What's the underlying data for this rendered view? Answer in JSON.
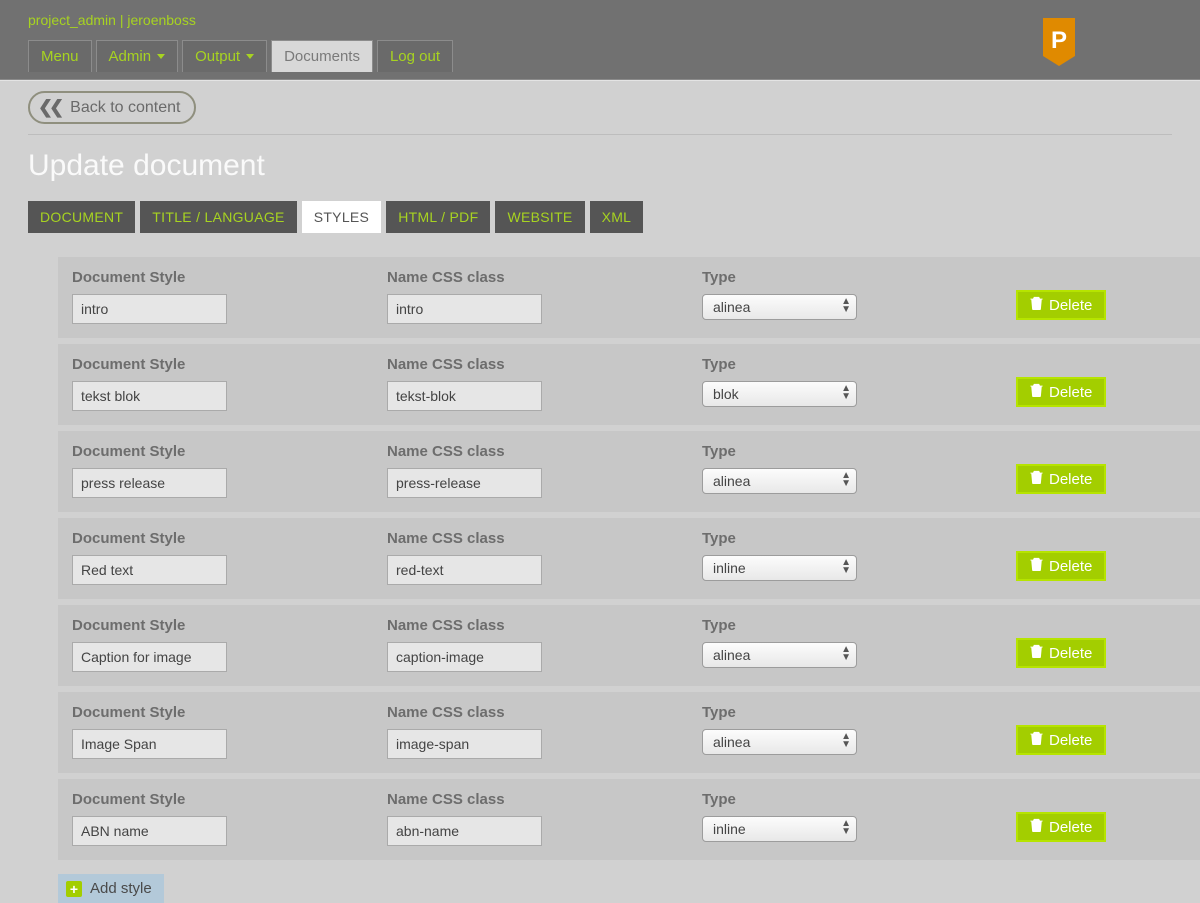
{
  "header": {
    "user_line": "project_admin | jeroenboss",
    "nav": [
      {
        "label": "Menu",
        "dropdown": false
      },
      {
        "label": "Admin",
        "dropdown": true
      },
      {
        "label": "Output",
        "dropdown": true
      },
      {
        "label": "Documents",
        "dropdown": false,
        "active": true
      },
      {
        "label": "Log out",
        "dropdown": false
      }
    ]
  },
  "back_button": "Back to content",
  "page_title": "Update document",
  "tabs": [
    {
      "label": "DOCUMENT"
    },
    {
      "label": "TITLE / LANGUAGE"
    },
    {
      "label": "STYLES",
      "active": true
    },
    {
      "label": "HTML / PDF"
    },
    {
      "label": "WEBSITE"
    },
    {
      "label": "XML"
    }
  ],
  "columns": {
    "doc_style": "Document Style",
    "css_class": "Name CSS class",
    "type": "Type"
  },
  "type_options": [
    "alinea",
    "blok",
    "inline"
  ],
  "rows": [
    {
      "doc_style": "intro",
      "css_class": "intro",
      "type": "alinea"
    },
    {
      "doc_style": "tekst blok",
      "css_class": "tekst-blok",
      "type": "blok"
    },
    {
      "doc_style": "press release",
      "css_class": "press-release",
      "type": "alinea"
    },
    {
      "doc_style": "Red text",
      "css_class": "red-text",
      "type": "inline"
    },
    {
      "doc_style": "Caption for image",
      "css_class": "caption-image",
      "type": "alinea"
    },
    {
      "doc_style": "Image Span",
      "css_class": "image-span",
      "type": "alinea"
    },
    {
      "doc_style": "ABN name",
      "css_class": "abn-name",
      "type": "inline"
    }
  ],
  "buttons": {
    "delete": "Delete",
    "add_style": "Add style"
  }
}
